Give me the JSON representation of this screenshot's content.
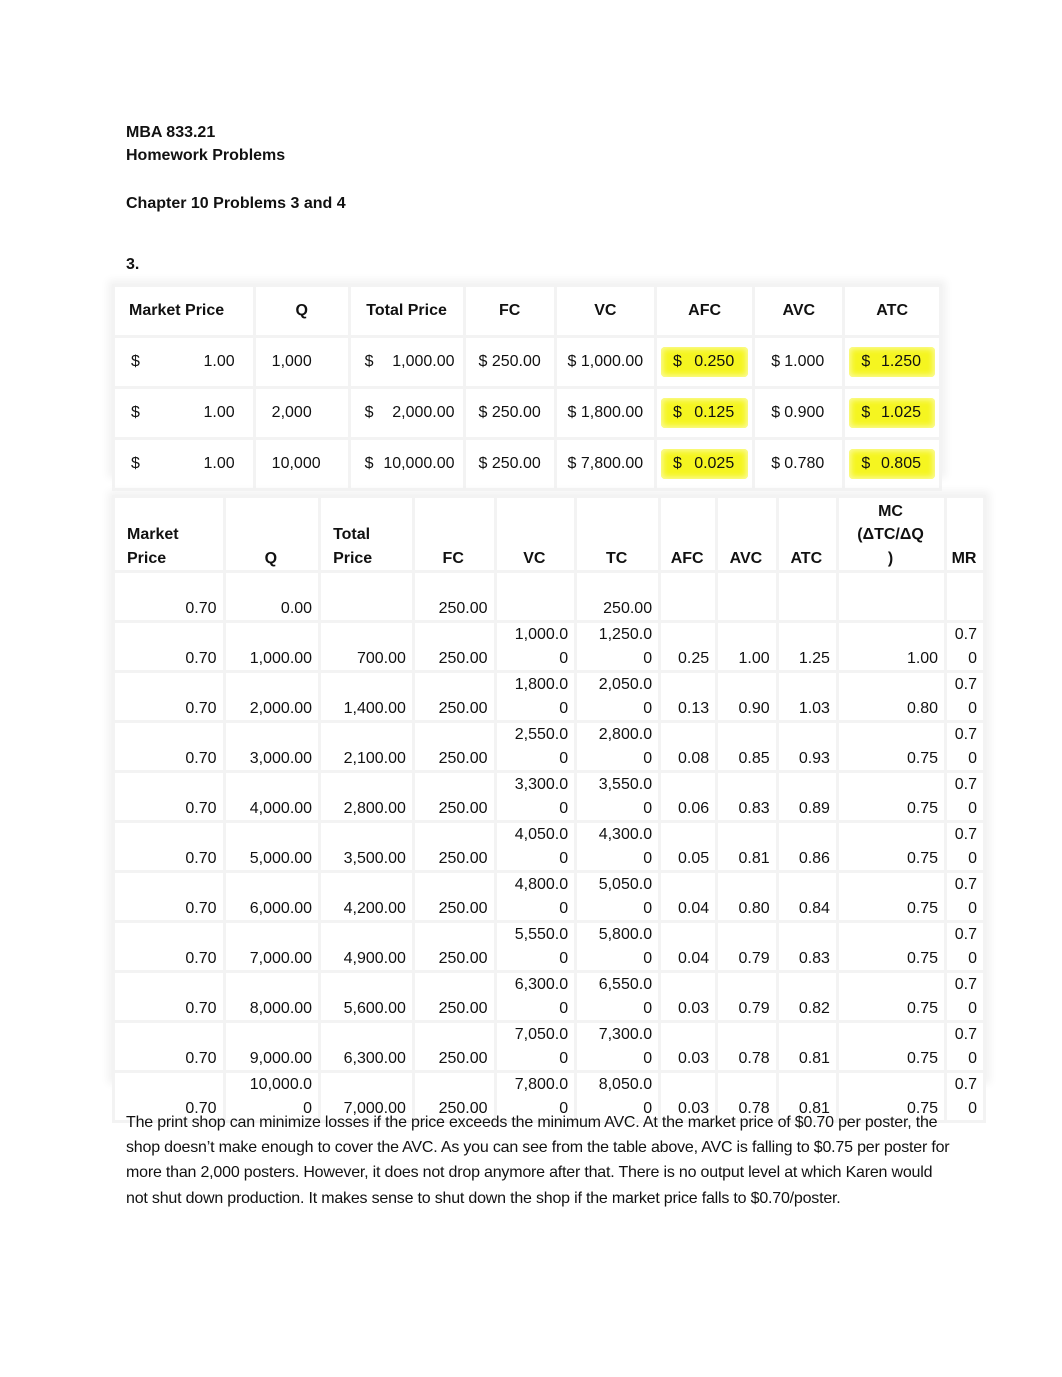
{
  "header": {
    "course": "MBA 833.21",
    "title": "Homework Problems",
    "chapter": "Chapter 10 Problems 3 and 4",
    "problem_number": "3."
  },
  "colors": {
    "highlight": "#f5f520"
  },
  "table1": {
    "headers": [
      "Market Price",
      "Q",
      "Total Price",
      "FC",
      "VC",
      "AFC",
      "AVC",
      "ATC"
    ],
    "rows": [
      {
        "market_price": "1.00",
        "q": "1,000",
        "total_price": "1,000.00",
        "fc": "$ 250.00",
        "vc": "$ 1,000.00",
        "afc": "0.250",
        "avc": "1.000",
        "atc": "1.250"
      },
      {
        "market_price": "1.00",
        "q": "2,000",
        "total_price": "2,000.00",
        "fc": "$ 250.00",
        "vc": "$ 1,800.00",
        "afc": "0.125",
        "avc": "0.900",
        "atc": "1.025"
      },
      {
        "market_price": "1.00",
        "q": "10,000",
        "total_price": "10,000.00",
        "fc": "$ 250.00",
        "vc": "$ 7,800.00",
        "afc": "0.025",
        "avc": "0.780",
        "atc": "0.805"
      }
    ],
    "currency_symbol": "$",
    "highlighted_columns": [
      "AFC",
      "ATC"
    ]
  },
  "table2": {
    "headers": {
      "market_price": [
        "Market",
        "Price"
      ],
      "q": "Q",
      "total_price": [
        "Total",
        "Price"
      ],
      "fc": "FC",
      "vc": "VC",
      "tc": "TC",
      "afc": "AFC",
      "avc": "AVC",
      "atc": "ATC",
      "mc": [
        "MC",
        "(ΔTC/ΔQ",
        ")"
      ],
      "mr": "MR"
    },
    "rows": [
      {
        "mp": "0.70",
        "q": [
          "0.00"
        ],
        "tp": "",
        "fc": "250.00",
        "vc": [
          "",
          ""
        ],
        "tc": [
          "250.00"
        ],
        "afc": "",
        "avc": "",
        "atc": "",
        "mc": "",
        "mr": [
          "",
          ""
        ]
      },
      {
        "mp": "0.70",
        "q": [
          "1,000.00"
        ],
        "tp": "700.00",
        "fc": "250.00",
        "vc": [
          "1,000.0",
          "0"
        ],
        "tc": [
          "1,250.0",
          "0"
        ],
        "afc": "0.25",
        "avc": "1.00",
        "atc": "1.25",
        "mc": "1.00",
        "mr": [
          "0.7",
          "0"
        ]
      },
      {
        "mp": "0.70",
        "q": [
          "2,000.00"
        ],
        "tp": "1,400.00",
        "fc": "250.00",
        "vc": [
          "1,800.0",
          "0"
        ],
        "tc": [
          "2,050.0",
          "0"
        ],
        "afc": "0.13",
        "avc": "0.90",
        "atc": "1.03",
        "mc": "0.80",
        "mr": [
          "0.7",
          "0"
        ]
      },
      {
        "mp": "0.70",
        "q": [
          "3,000.00"
        ],
        "tp": "2,100.00",
        "fc": "250.00",
        "vc": [
          "2,550.0",
          "0"
        ],
        "tc": [
          "2,800.0",
          "0"
        ],
        "afc": "0.08",
        "avc": "0.85",
        "atc": "0.93",
        "mc": "0.75",
        "mr": [
          "0.7",
          "0"
        ]
      },
      {
        "mp": "0.70",
        "q": [
          "4,000.00"
        ],
        "tp": "2,800.00",
        "fc": "250.00",
        "vc": [
          "3,300.0",
          "0"
        ],
        "tc": [
          "3,550.0",
          "0"
        ],
        "afc": "0.06",
        "avc": "0.83",
        "atc": "0.89",
        "mc": "0.75",
        "mr": [
          "0.7",
          "0"
        ]
      },
      {
        "mp": "0.70",
        "q": [
          "5,000.00"
        ],
        "tp": "3,500.00",
        "fc": "250.00",
        "vc": [
          "4,050.0",
          "0"
        ],
        "tc": [
          "4,300.0",
          "0"
        ],
        "afc": "0.05",
        "avc": "0.81",
        "atc": "0.86",
        "mc": "0.75",
        "mr": [
          "0.7",
          "0"
        ]
      },
      {
        "mp": "0.70",
        "q": [
          "6,000.00"
        ],
        "tp": "4,200.00",
        "fc": "250.00",
        "vc": [
          "4,800.0",
          "0"
        ],
        "tc": [
          "5,050.0",
          "0"
        ],
        "afc": "0.04",
        "avc": "0.80",
        "atc": "0.84",
        "mc": "0.75",
        "mr": [
          "0.7",
          "0"
        ]
      },
      {
        "mp": "0.70",
        "q": [
          "7,000.00"
        ],
        "tp": "4,900.00",
        "fc": "250.00",
        "vc": [
          "5,550.0",
          "0"
        ],
        "tc": [
          "5,800.0",
          "0"
        ],
        "afc": "0.04",
        "avc": "0.79",
        "atc": "0.83",
        "mc": "0.75",
        "mr": [
          "0.7",
          "0"
        ]
      },
      {
        "mp": "0.70",
        "q": [
          "8,000.00"
        ],
        "tp": "5,600.00",
        "fc": "250.00",
        "vc": [
          "6,300.0",
          "0"
        ],
        "tc": [
          "6,550.0",
          "0"
        ],
        "afc": "0.03",
        "avc": "0.79",
        "atc": "0.82",
        "mc": "0.75",
        "mr": [
          "0.7",
          "0"
        ]
      },
      {
        "mp": "0.70",
        "q": [
          "9,000.00"
        ],
        "tp": "6,300.00",
        "fc": "250.00",
        "vc": [
          "7,050.0",
          "0"
        ],
        "tc": [
          "7,300.0",
          "0"
        ],
        "afc": "0.03",
        "avc": "0.78",
        "atc": "0.81",
        "mc": "0.75",
        "mr": [
          "0.7",
          "0"
        ]
      },
      {
        "mp": "0.70",
        "q": [
          "10,000.0",
          "0"
        ],
        "tp": "7,000.00",
        "fc": "250.00",
        "vc": [
          "7,800.0",
          "0"
        ],
        "tc": [
          "8,050.0",
          "0"
        ],
        "afc": "0.03",
        "avc": "0.78",
        "atc": "0.81",
        "mc": "0.75",
        "mr": [
          "0.7",
          "0"
        ]
      }
    ]
  },
  "conclusion": "The print shop can minimize losses if the price exceeds the minimum AVC. At the market price of $0.70 per poster, the shop doesn’t make enough to cover the AVC. As you can see from the table above, AVC is falling to $0.75 per poster for more than 2,000 posters. However, it does not drop anymore after that. There is no output level at which Karen would not shut down production. It makes sense to shut down the shop if the market price falls to $0.70/poster."
}
